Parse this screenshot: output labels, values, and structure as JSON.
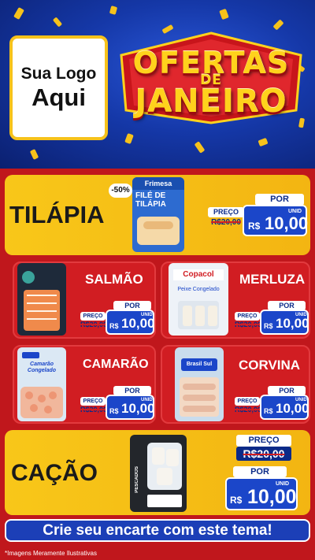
{
  "header": {
    "logo_line1": "Sua Logo",
    "logo_line2": "Aqui",
    "title_line1": "OFERTAS",
    "title_line2": "DE",
    "title_line3": "JANEIRO"
  },
  "products": [
    {
      "id": "tilapia",
      "name": "TILÁPIA",
      "pack_brand": "Frimesa",
      "pack_label": "FILÉ DE TILÁPIA",
      "discount": "-50%",
      "preco_label": "PREÇO",
      "old_price": "R$20,00",
      "por_label": "POR",
      "currency": "R$",
      "price": "10,00",
      "unit": "UNID"
    },
    {
      "id": "salmao",
      "name": "SALMÃO",
      "preco_label": "PREÇO",
      "old_price": "R$20,00",
      "por_label": "POR",
      "currency": "R$",
      "price": "10,00",
      "unit": "UNID"
    },
    {
      "id": "merluza",
      "name": "MERLUZA",
      "pack_brand": "Copacol",
      "pack_label": "Peixe Congelado",
      "preco_label": "PREÇO",
      "old_price": "R$20,00",
      "por_label": "POR",
      "currency": "R$",
      "price": "10,00",
      "unit": "UNID"
    },
    {
      "id": "camarao",
      "name": "CAMARÃO",
      "pack_label": "Camarão Congelado",
      "preco_label": "PREÇO",
      "old_price": "R$20,00",
      "por_label": "POR",
      "currency": "R$",
      "price": "10,00",
      "unit": "UNID"
    },
    {
      "id": "corvina",
      "name": "CORVINA",
      "pack_brand": "Brasil Sul",
      "preco_label": "PREÇO",
      "old_price": "R$20,00",
      "por_label": "POR",
      "currency": "R$",
      "price": "10,00",
      "unit": "UNID"
    },
    {
      "id": "cacao",
      "name": "CAÇÃO",
      "pack_label": "PESCADOS",
      "preco_label": "PREÇO",
      "old_price": "R$20,00",
      "por_label": "POR",
      "currency": "R$",
      "price": "10,00",
      "unit": "UNID"
    }
  ],
  "cta": "Crie seu encarte com este tema!",
  "disclaimer": "*Imagens Meramente Ilustrativas",
  "colors": {
    "blue": "#1b46c9",
    "yellow": "#f6c21b",
    "red": "#c0171c"
  }
}
